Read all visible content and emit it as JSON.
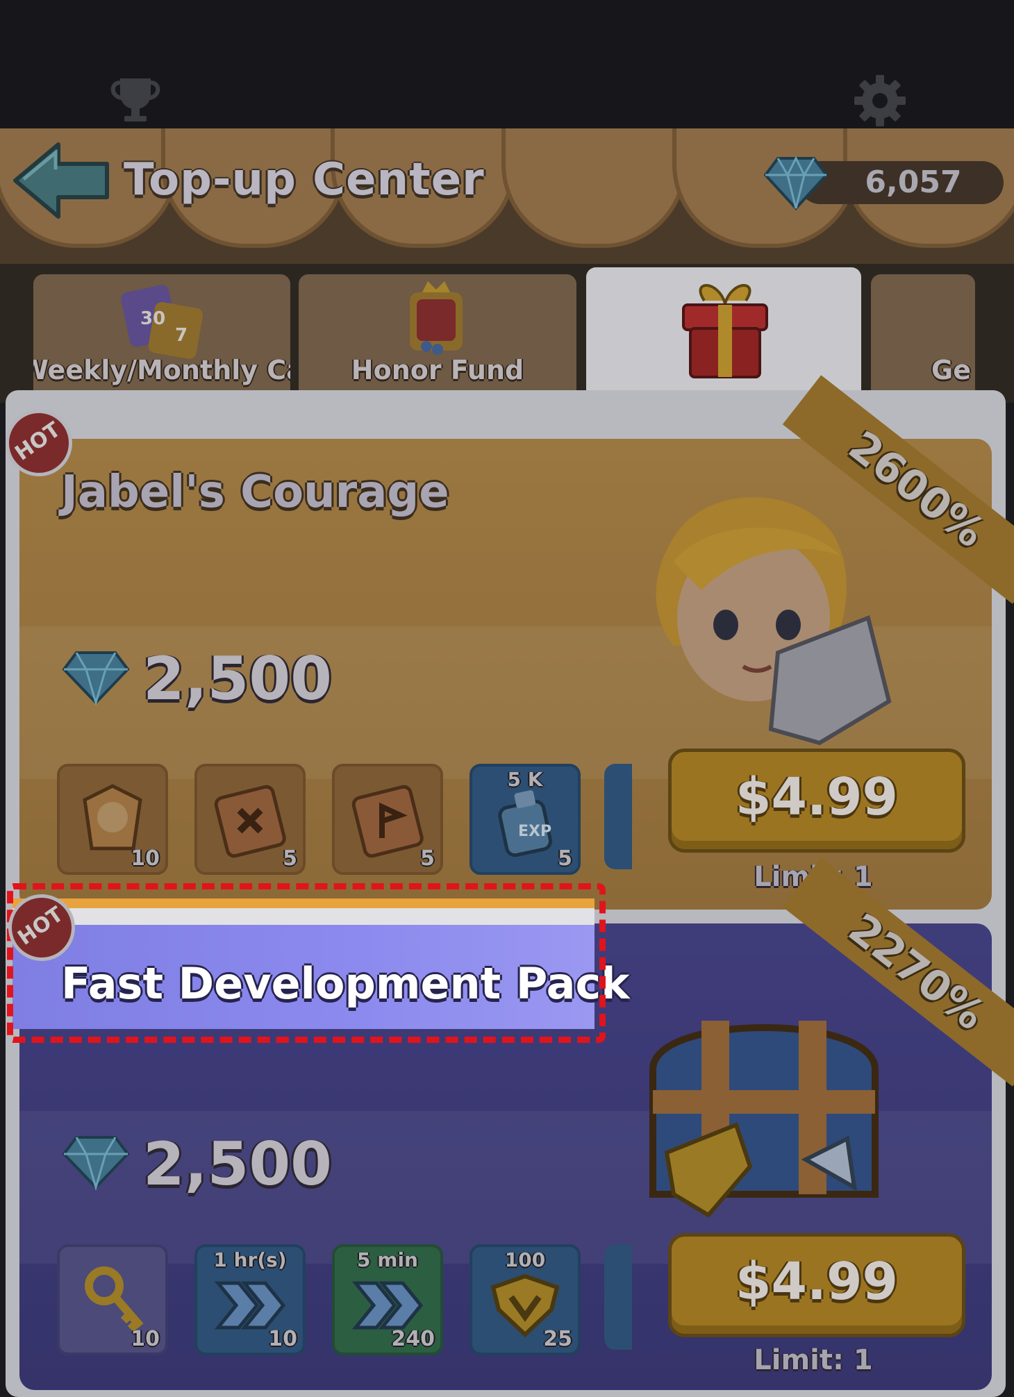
{
  "header": {
    "title": "Top-up Center",
    "gem_balance": "6,057"
  },
  "tabs": [
    {
      "label": "Weekly/Monthly Cards",
      "active": false
    },
    {
      "label": "Honor Fund",
      "active": false
    },
    {
      "label": "",
      "active": true,
      "icon": "gift-icon"
    },
    {
      "label": "Ge",
      "active": false
    }
  ],
  "packs": [
    {
      "badge": "HOT",
      "title": "Jabel's Courage",
      "bonus": "2600%",
      "diamonds": "2,500",
      "price": "$4.99",
      "limit": "Limit: 1",
      "items": [
        {
          "icon": "hero-shard-icon",
          "count": "10",
          "top": ""
        },
        {
          "icon": "skill-book-icon",
          "count": "5",
          "top": ""
        },
        {
          "icon": "flag-book-icon",
          "count": "5",
          "top": ""
        },
        {
          "icon": "exp-potion-icon",
          "count": "5",
          "top": "5 K"
        }
      ]
    },
    {
      "badge": "HOT",
      "title": "Fast Development Pack",
      "bonus": "2270%",
      "diamonds": "2,500",
      "price": "$4.99",
      "limit": "Limit: 1",
      "items": [
        {
          "icon": "key-icon",
          "count": "10",
          "top": ""
        },
        {
          "icon": "speedup-icon",
          "count": "10",
          "top": "1 hr(s)"
        },
        {
          "icon": "speedup-icon",
          "count": "240",
          "top": "5 min"
        },
        {
          "icon": "badge-icon",
          "count": "25",
          "top": "100"
        }
      ]
    }
  ],
  "colors": {
    "highlight_dash": "#e0141c",
    "card1": "#9a7640",
    "card2": "#3f3c7a",
    "title_highlight_bg": "#8c8aee"
  }
}
